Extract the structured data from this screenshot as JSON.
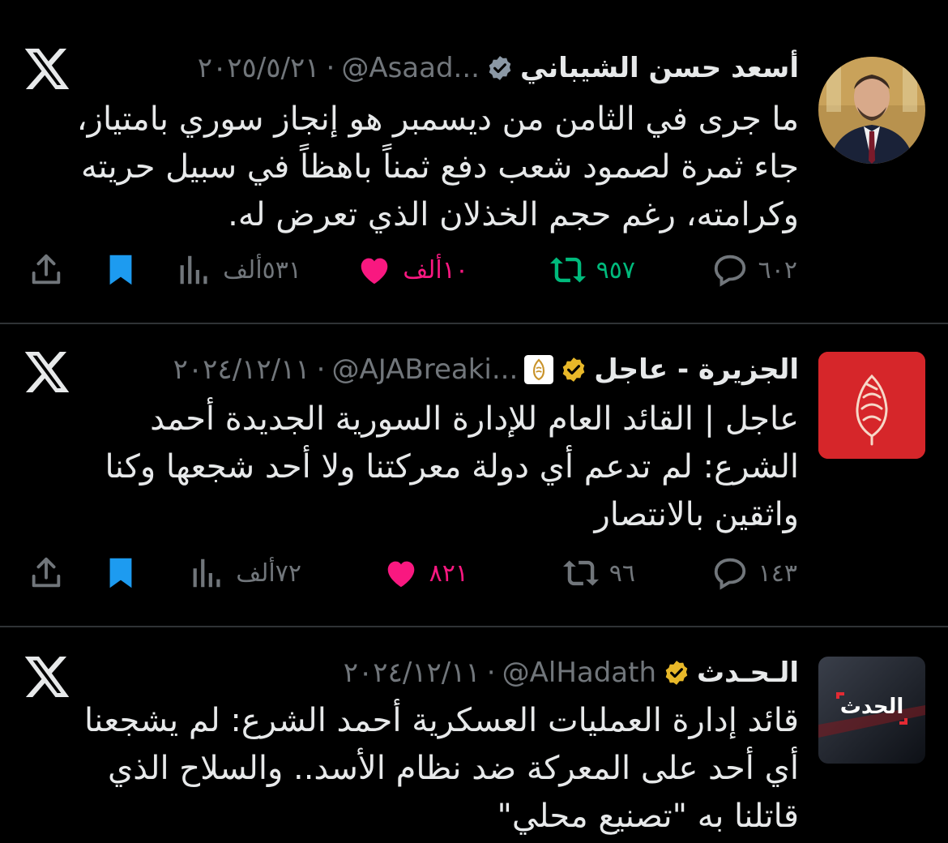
{
  "tweets": [
    {
      "name": "أسعد حسن الشيباني",
      "handle": "@Asaad...",
      "date": "٢٠٢٥/٥/٢١",
      "separator": "·",
      "verified_color": "#8b98a5",
      "text": "ما جرى في الثامن من ديسمبر هو إنجاز سوري بامتياز، جاء ثمرة لصمود شعب دفع ثمناً باهظاً في سبيل حريته وكرامته، رغم حجم الخذلان الذي تعرض له.",
      "replies": "٦٠٢",
      "reposts": "٩٥٧",
      "likes": "١٠ألف",
      "views": "٥٣١ألف",
      "repost_color": "#00ba7c",
      "like_color": "#f91880",
      "bookmark_color": "#1d9bf0"
    },
    {
      "name": "الجزيرة - عاجل",
      "handle": "@AJABreaki...",
      "date": "٢٠٢٤/١٢/١١",
      "separator": "·",
      "verified_color": "#e8b829",
      "text": "عاجل | القائد العام للإدارة السورية الجديدة أحمد الشرع: لم تدعم أي دولة معركتنا ولا أحد شجعها وكنا واثقين بالانتصار",
      "replies": "١٤٣",
      "reposts": "٩٦",
      "likes": "٨٢١",
      "views": "٧٢ألف",
      "like_color": "#f91880",
      "bookmark_color": "#1d9bf0"
    },
    {
      "name": "الـحـدث",
      "handle": "@AlHadath",
      "date": "٢٠٢٤/١٢/١١",
      "separator": "·",
      "verified_color": "#e8b829",
      "text": "قائد إدارة العمليات العسكرية أحمد الشرع: لم يشجعنا أي أحد على المعركة ضد نظام الأسد.. والسلاح الذي قاتلنا به \"تصنيع محلي\"",
      "avatar_text": "الحدث"
    }
  ]
}
